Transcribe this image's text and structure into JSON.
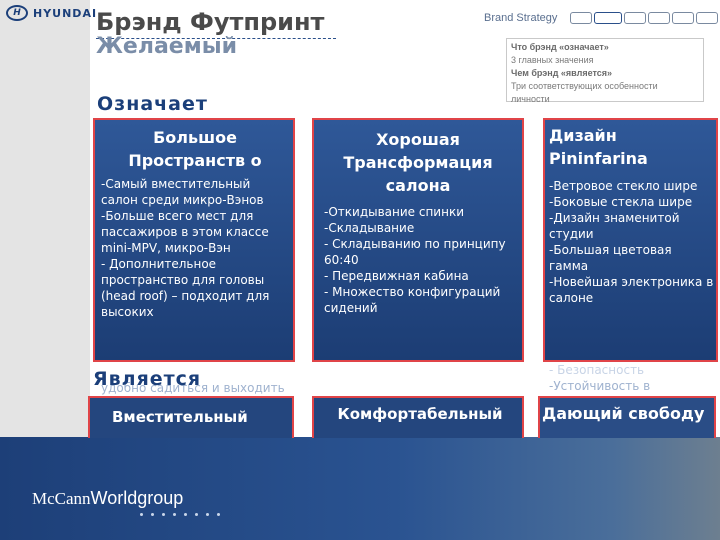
{
  "header": {
    "logo_mark": "H",
    "logo_text": "HYUNDAI",
    "title_line1": "Брэнд Футпринт",
    "title_line2": "Желаемый",
    "strategy_label": "Brand Strategy",
    "progress_steps": 6,
    "progress_active_step": 2
  },
  "infobox": {
    "line1": "Что брэнд «означает»",
    "line2": "3 главных значения",
    "line3": "Чем брэнд «является»",
    "line4": "Три соответствующих особенности",
    "line5": "личности"
  },
  "sections": {
    "means": "Означает",
    "is": "Является"
  },
  "cards": [
    {
      "title": "Большое Пространств о",
      "body": "-Самый вместительный салон среди микро-Вэнов\n-Больше всего мест для пассажиров в этом классе mini-MPV, микро-Вэн\n- Дополнительное пространство для головы (head roof) – подходит для высоких",
      "faded": "удобно садиться и выходить из"
    },
    {
      "title": "Хорошая Трансформация салона",
      "body": "-Откидывание спинки\n-Складывание\n- Складыванию по принципу 60:40\n- Передвижная кабина\n- Множество конфигураций сидений"
    },
    {
      "title": "Дизайн Pininfarina",
      "body": "-Ветровое стекло шире\n-Боковые стекла шире\n-Дизайн знаменитой студии\n-Большая цветовая гамма\n-Новейшая электроника в салоне",
      "faded_1": "- Безопасность",
      "faded_2": "-Устойчивость в управлении"
    }
  ],
  "personality": [
    "Вместительный",
    "Комфортабельный",
    "Дающий свободу"
  ],
  "footer": {
    "brand_mc": "McCann",
    "brand_wg": "Worldgroup"
  },
  "colors": {
    "accent_blue": "#1b3f7a",
    "card_border": "#e04448",
    "card_fill": "#2f5898"
  }
}
